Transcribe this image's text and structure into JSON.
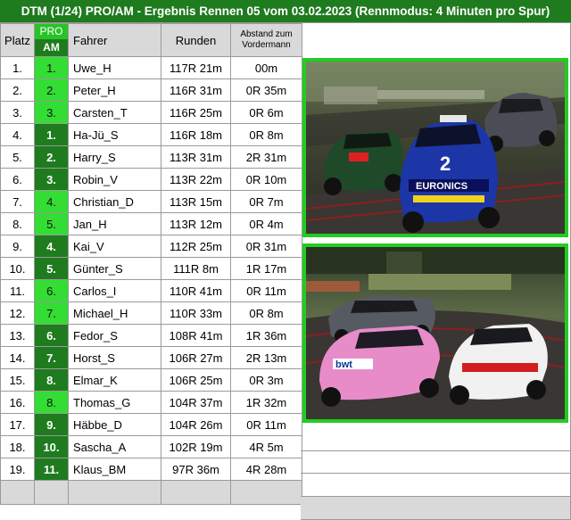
{
  "title": "DTM (1/24) PRO/AM - Ergebnis Rennen 05 vom 03.02.2023 (Rennmodus: 4 Minuten pro Spur)",
  "headers": {
    "platz": "Platz",
    "pro": "PRO",
    "am": "AM",
    "fahrer": "Fahrer",
    "runden": "Runden",
    "abstand": "Abstand zum Vordermann"
  },
  "rows": [
    {
      "platz": "1.",
      "klasse": "1.",
      "cls": "pro",
      "fahrer": "Uwe_H",
      "runden": "117R 21m",
      "abstand": "00m"
    },
    {
      "platz": "2.",
      "klasse": "2.",
      "cls": "pro",
      "fahrer": "Peter_H",
      "runden": "116R 31m",
      "abstand": "0R 35m"
    },
    {
      "platz": "3.",
      "klasse": "3.",
      "cls": "pro",
      "fahrer": "Carsten_T",
      "runden": "116R 25m",
      "abstand": "0R 6m"
    },
    {
      "platz": "4.",
      "klasse": "1.",
      "cls": "am",
      "fahrer": "Ha-Jü_S",
      "runden": "116R 18m",
      "abstand": "0R 8m"
    },
    {
      "platz": "5.",
      "klasse": "2.",
      "cls": "am",
      "fahrer": "Harry_S",
      "runden": "113R 31m",
      "abstand": "2R 31m"
    },
    {
      "platz": "6.",
      "klasse": "3.",
      "cls": "am",
      "fahrer": "Robin_V",
      "runden": "113R 22m",
      "abstand": "0R 10m"
    },
    {
      "platz": "7.",
      "klasse": "4.",
      "cls": "pro",
      "fahrer": "Christian_D",
      "runden": "113R 15m",
      "abstand": "0R 7m"
    },
    {
      "platz": "8.",
      "klasse": "5.",
      "cls": "pro",
      "fahrer": "Jan_H",
      "runden": "113R 12m",
      "abstand": "0R 4m"
    },
    {
      "platz": "9.",
      "klasse": "4.",
      "cls": "am",
      "fahrer": "Kai_V",
      "runden": "112R 25m",
      "abstand": "0R 31m"
    },
    {
      "platz": "10.",
      "klasse": "5.",
      "cls": "am",
      "fahrer": "Günter_S",
      "runden": "111R 8m",
      "abstand": "1R 17m"
    },
    {
      "platz": "11.",
      "klasse": "6.",
      "cls": "pro",
      "fahrer": "Carlos_I",
      "runden": "110R 41m",
      "abstand": "0R 11m"
    },
    {
      "platz": "12.",
      "klasse": "7.",
      "cls": "pro",
      "fahrer": "Michael_H",
      "runden": "110R 33m",
      "abstand": "0R 8m"
    },
    {
      "platz": "13.",
      "klasse": "6.",
      "cls": "am",
      "fahrer": "Fedor_S",
      "runden": "108R 41m",
      "abstand": "1R 36m"
    },
    {
      "platz": "14.",
      "klasse": "7.",
      "cls": "am",
      "fahrer": "Horst_S",
      "runden": "106R 27m",
      "abstand": "2R 13m"
    },
    {
      "platz": "15.",
      "klasse": "8.",
      "cls": "am",
      "fahrer": "Elmar_K",
      "runden": "106R 25m",
      "abstand": "0R 3m"
    },
    {
      "platz": "16.",
      "klasse": "8.",
      "cls": "pro",
      "fahrer": "Thomas_G",
      "runden": "104R 37m",
      "abstand": "1R 32m"
    },
    {
      "platz": "17.",
      "klasse": "9.",
      "cls": "am",
      "fahrer": "Häbbe_D",
      "runden": "104R 26m",
      "abstand": "0R 11m"
    },
    {
      "platz": "18.",
      "klasse": "10.",
      "cls": "am",
      "fahrer": "Sascha_A",
      "runden": "102R 19m",
      "abstand": "4R 5m"
    },
    {
      "platz": "19.",
      "klasse": "11.",
      "cls": "am",
      "fahrer": "Klaus_BM",
      "runden": "97R 36m",
      "abstand": "4R 28m"
    }
  ],
  "photos": {
    "top_car_number": "2",
    "top_car_sponsor": "EURONICS",
    "bottom_car_sponsor": "bwt"
  },
  "colors": {
    "title_bg": "#1e7b1e",
    "pro_bg": "#33dd33",
    "am_bg": "#1e7b1e",
    "photo_frame": "#22cc22"
  }
}
